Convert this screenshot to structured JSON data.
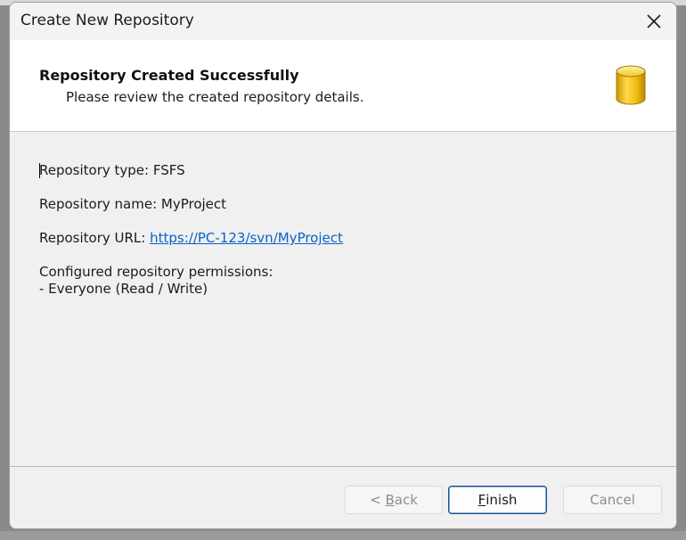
{
  "window": {
    "title": "Create New Repository"
  },
  "header": {
    "title": "Repository Created Successfully",
    "subtitle": "Please review the created repository details.",
    "icon": "database-cylinder-icon"
  },
  "details": {
    "type_label": "Repository type: FSFS",
    "name_label": "Repository name: MyProject",
    "url_prefix": "Repository URL: ",
    "url": "https://PC-123/svn/MyProject",
    "permissions_heading": "Configured repository permissions:",
    "permissions": [
      "- Everyone (Read / Write)"
    ]
  },
  "buttons": {
    "back": {
      "prefix": "< ",
      "accel": "B",
      "rest": "ack"
    },
    "finish": {
      "accel": "F",
      "rest": "inish"
    },
    "cancel": "Cancel"
  },
  "colors": {
    "link": "#0a62c7",
    "icon_gold": "#e8b400"
  }
}
